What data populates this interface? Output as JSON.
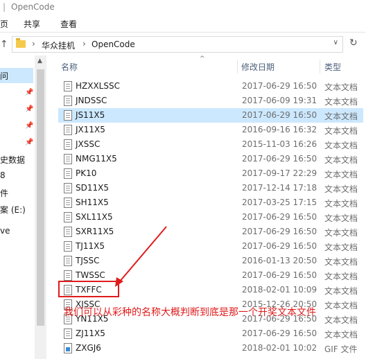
{
  "window": {
    "title": "OpenCode"
  },
  "ribbon": {
    "tabs": [
      "页",
      "共享",
      "查看"
    ]
  },
  "address": {
    "crumbs": [
      "华众挂机",
      "OpenCode"
    ],
    "separator": "›"
  },
  "nav": {
    "items": [
      {
        "label": "问",
        "pinned": false
      },
      {
        "label": "",
        "pinned": true
      },
      {
        "label": "",
        "pinned": true
      },
      {
        "label": "",
        "pinned": true
      },
      {
        "label": "",
        "pinned": true
      },
      {
        "label": "史数据",
        "pinned": false
      },
      {
        "label": "8",
        "pinned": false
      },
      {
        "label": "件",
        "pinned": false
      },
      {
        "label": "案 (E:)",
        "pinned": false
      },
      {
        "label": "ve",
        "pinned": false
      }
    ]
  },
  "columns": {
    "name": "名称",
    "modified": "修改日期",
    "type": "类型"
  },
  "files": [
    {
      "name": "HZXXLSSC",
      "date": "2017-06-29 16:50",
      "type": "文本文档",
      "icon": "text-file-icon"
    },
    {
      "name": "JNDSSC",
      "date": "2017-06-09 19:31",
      "type": "文本文档",
      "icon": "text-file-icon"
    },
    {
      "name": "JS11X5",
      "date": "2017-06-29 16:50",
      "type": "文本文档",
      "icon": "text-file-icon"
    },
    {
      "name": "JX11X5",
      "date": "2016-09-16 16:32",
      "type": "文本文档",
      "icon": "text-file-icon"
    },
    {
      "name": "JXSSC",
      "date": "2015-11-03 16:26",
      "type": "文本文档",
      "icon": "text-file-icon"
    },
    {
      "name": "NMG11X5",
      "date": "2017-06-29 16:50",
      "type": "文本文档",
      "icon": "text-file-icon"
    },
    {
      "name": "PK10",
      "date": "2017-09-17 22:29",
      "type": "文本文档",
      "icon": "text-file-icon"
    },
    {
      "name": "SD11X5",
      "date": "2017-12-14 17:18",
      "type": "文本文档",
      "icon": "text-file-icon"
    },
    {
      "name": "SH11X5",
      "date": "2017-03-25 17:15",
      "type": "文本文档",
      "icon": "text-file-icon"
    },
    {
      "name": "SXL11X5",
      "date": "2017-06-29 16:50",
      "type": "文本文档",
      "icon": "text-file-icon"
    },
    {
      "name": "SXR11X5",
      "date": "2017-06-29 16:50",
      "type": "文本文档",
      "icon": "text-file-icon"
    },
    {
      "name": "TJ11X5",
      "date": "2017-06-29 16:50",
      "type": "文本文档",
      "icon": "text-file-icon"
    },
    {
      "name": "TJSSC",
      "date": "2016-01-13 20:50",
      "type": "文本文档",
      "icon": "text-file-icon"
    },
    {
      "name": "TWSSC",
      "date": "2017-06-29 16:50",
      "type": "文本文档",
      "icon": "text-file-icon"
    },
    {
      "name": "TXFFC",
      "date": "2018-02-01 10:09",
      "type": "文本文档",
      "icon": "text-file-icon"
    },
    {
      "name": "XJSSC",
      "date": "2015-12-26 20:50",
      "type": "文本文档",
      "icon": "text-file-icon"
    },
    {
      "name": "YN11X5",
      "date": "2017-06-29 16:50",
      "type": "文本文档",
      "icon": "text-file-icon"
    },
    {
      "name": "ZJ11X5",
      "date": "2017-06-29 16:50",
      "type": "文本文档",
      "icon": "text-file-icon"
    },
    {
      "name": "ZXGJ6",
      "date": "2018-02-01 10:02",
      "type": "GIF 文件",
      "icon": "gif-image-icon"
    }
  ],
  "annotation": {
    "text": "我们可以从彩种的名称大概判断到底是那一个开奖文本文件",
    "color": "#e01b1b"
  }
}
